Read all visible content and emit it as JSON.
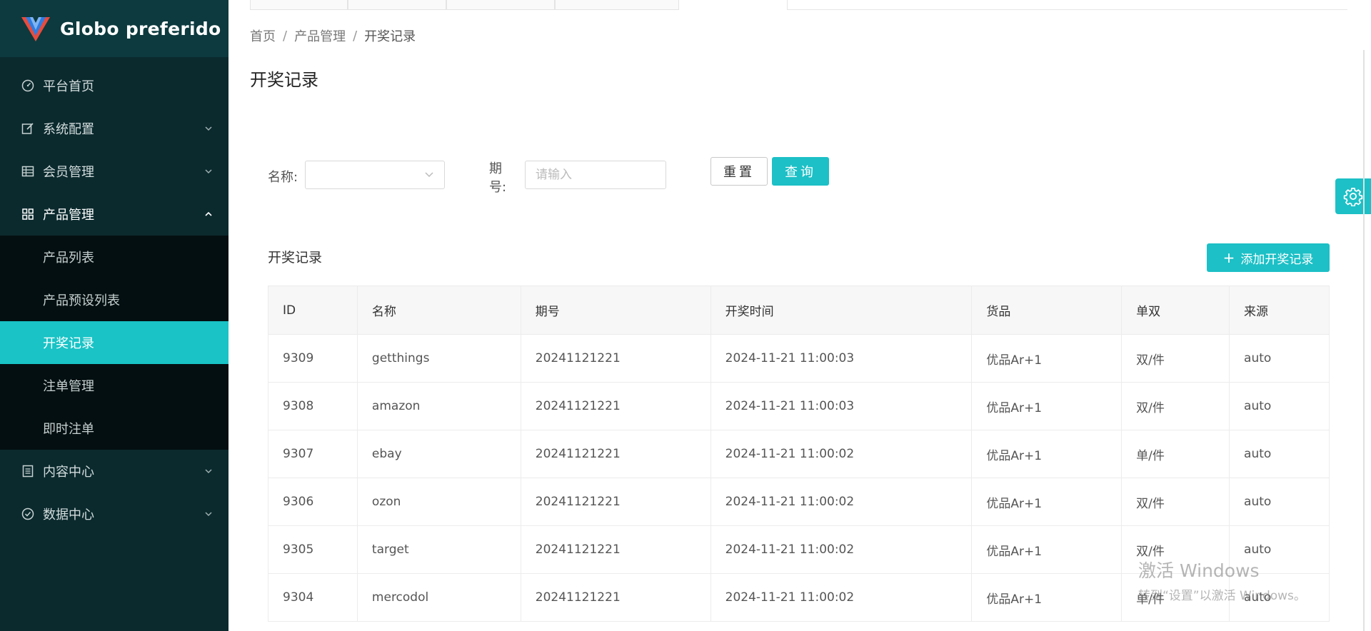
{
  "app": {
    "title": "Globo preferido"
  },
  "sidebar": {
    "items": [
      {
        "label": "平台首页",
        "icon": "dashboard-icon"
      },
      {
        "label": "系统配置",
        "icon": "edit-icon"
      },
      {
        "label": "会员管理",
        "icon": "table-icon"
      },
      {
        "label": "产品管理",
        "icon": "grid-icon"
      },
      {
        "label": "内容中心",
        "icon": "document-icon"
      },
      {
        "label": "数据中心",
        "icon": "check-circle-icon"
      }
    ],
    "submenu": [
      "产品列表",
      "产品预设列表",
      "开奖记录",
      "注单管理",
      "即时注单"
    ],
    "active": "开奖记录"
  },
  "breadcrumb": [
    "首页",
    "产品管理",
    "开奖记录"
  ],
  "breadcrumb_sep": "/",
  "page": {
    "title": "开奖记录"
  },
  "filter": {
    "name_label": "名称:",
    "period_label_1": "期",
    "period_label_2": "号:",
    "period_placeholder": "请输入",
    "reset_label": "重置",
    "query_label": "查询"
  },
  "section": {
    "title": "开奖记录",
    "add_label": "添加开奖记录",
    "add_symbol": "+"
  },
  "table": {
    "headers": [
      "ID",
      "名称",
      "期号",
      "开奖时间",
      "货品",
      "单双",
      "来源"
    ],
    "rows": [
      [
        "9309",
        "getthings",
        "20241121221",
        "2024-11-21 11:00:03",
        "优品Ar+1",
        "双/件",
        "auto"
      ],
      [
        "9308",
        "amazon",
        "20241121221",
        "2024-11-21 11:00:03",
        "优品Ar+1",
        "双/件",
        "auto"
      ],
      [
        "9307",
        "ebay",
        "20241121221",
        "2024-11-21 11:00:02",
        "优品Ar+1",
        "单/件",
        "auto"
      ],
      [
        "9306",
        "ozon",
        "20241121221",
        "2024-11-21 11:00:02",
        "优品Ar+1",
        "双/件",
        "auto"
      ],
      [
        "9305",
        "target",
        "20241121221",
        "2024-11-21 11:00:02",
        "优品Ar+1",
        "双/件",
        "auto"
      ],
      [
        "9304",
        "mercodol",
        "20241121221",
        "2024-11-21 11:00:02",
        "优品Ar+1",
        "单/件",
        "auto"
      ]
    ]
  },
  "watermark": {
    "line1": "激活 Windows",
    "line2": "转到“设置”以激活 Windows。"
  },
  "colors": {
    "accent": "#1cc0c6",
    "sidebar_bg": "#0b2a2e",
    "submenu_bg": "#040f11"
  },
  "icons": {
    "settings": "gear-icon",
    "chevron": "chevron-down-icon"
  }
}
